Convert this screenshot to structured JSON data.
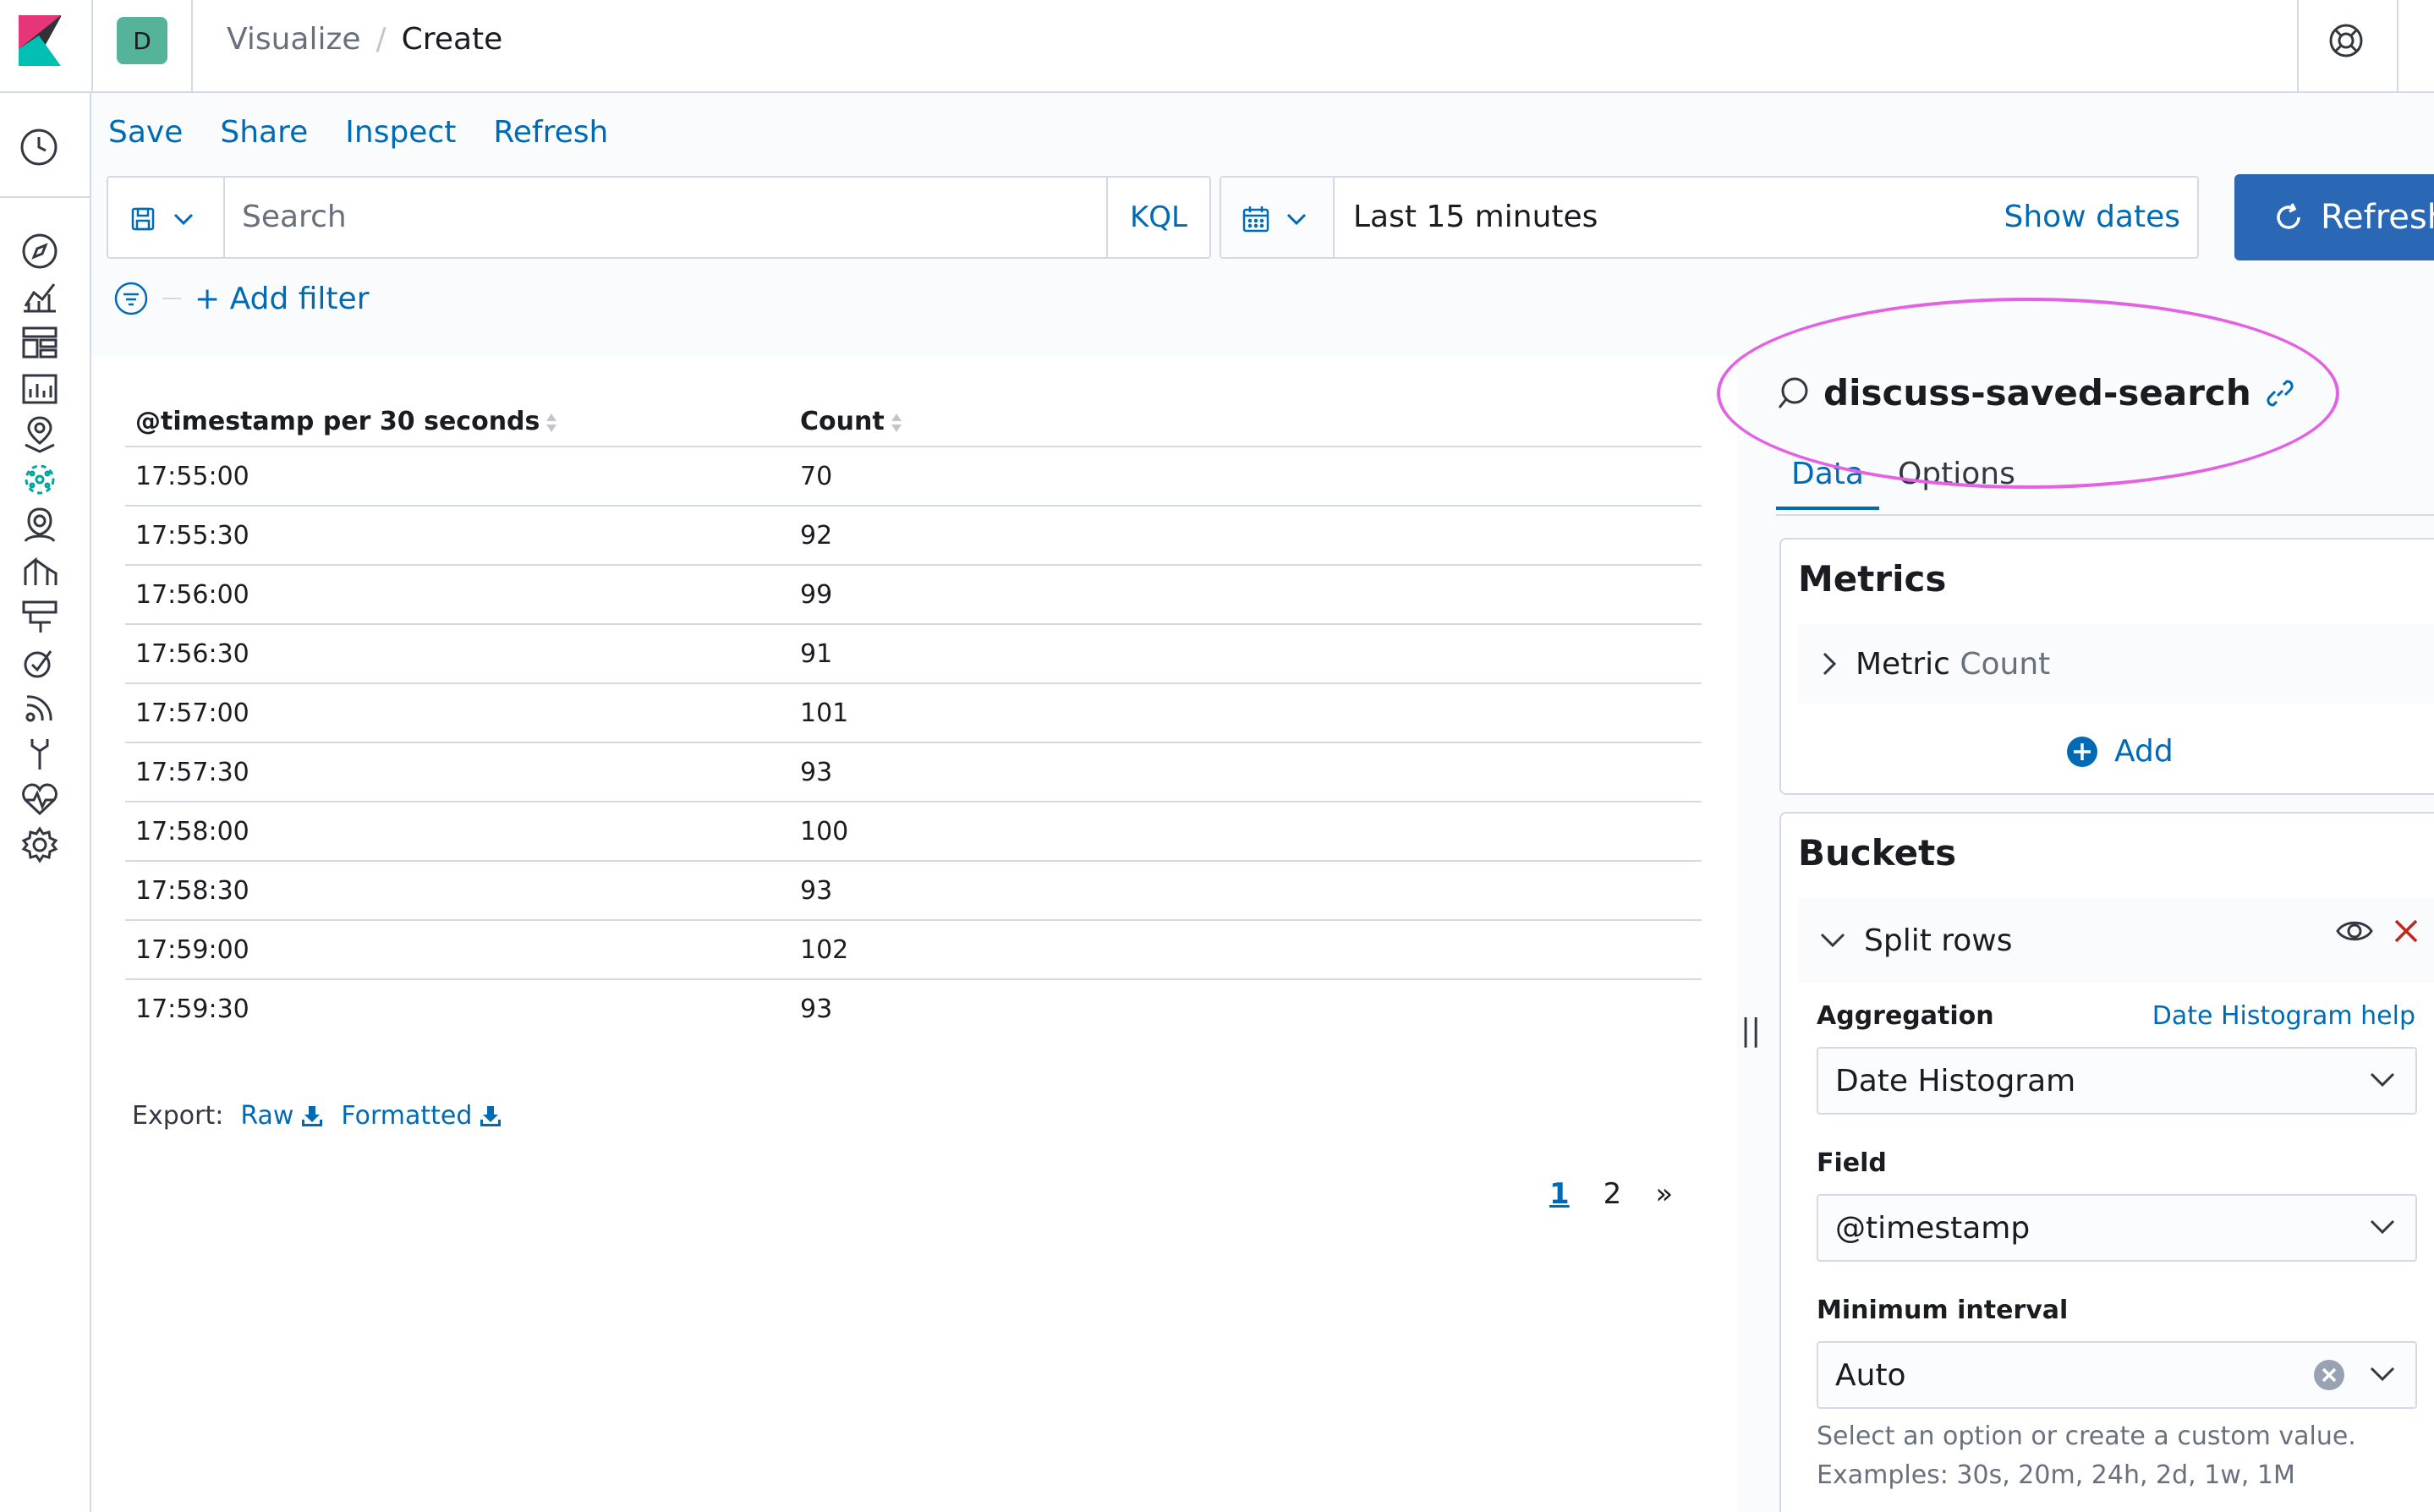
{
  "header": {
    "space_initial": "D",
    "breadcrumbs": [
      "Visualize",
      "/",
      "Create"
    ]
  },
  "nav": {
    "icons": [
      "recently-viewed-icon",
      "discover-icon",
      "visualize-icon",
      "dashboard-icon",
      "canvas-icon",
      "maps-icon",
      "machine-learning-icon",
      "siem-icon",
      "apm-icon",
      "uptime-icon",
      "graph-icon",
      "infrastructure-icon",
      "dev-tools-icon",
      "stack-monitoring-icon",
      "management-icon"
    ]
  },
  "top_actions": [
    "Save",
    "Share",
    "Inspect",
    "Refresh"
  ],
  "query_bar": {
    "placeholder": "Search",
    "language": "KQL"
  },
  "date_picker": {
    "range": "Last 15 minutes",
    "show_dates": "Show dates"
  },
  "refresh_button": "Refresh",
  "filter": {
    "add_label": "+ Add filter"
  },
  "table": {
    "columns": [
      "@timestamp per 30 seconds",
      "Count"
    ],
    "rows": [
      [
        "17:55:00",
        "70"
      ],
      [
        "17:55:30",
        "92"
      ],
      [
        "17:56:00",
        "99"
      ],
      [
        "17:56:30",
        "91"
      ],
      [
        "17:57:00",
        "101"
      ],
      [
        "17:57:30",
        "93"
      ],
      [
        "17:58:00",
        "100"
      ],
      [
        "17:58:30",
        "93"
      ],
      [
        "17:59:00",
        "102"
      ],
      [
        "17:59:30",
        "93"
      ]
    ],
    "export_label": "Export:",
    "export_raw": "Raw",
    "export_formatted": "Formatted",
    "pages": [
      "1",
      "2",
      "»"
    ],
    "current_page": "1"
  },
  "sidebar": {
    "saved_search_title": "discuss-saved-search",
    "tabs": [
      "Data",
      "Options"
    ],
    "metrics": {
      "title": "Metrics",
      "item_label": "Metric",
      "item_agg": "Count",
      "add_label": "Add"
    },
    "buckets": {
      "title": "Buckets",
      "item_label": "Split rows",
      "aggregation_label": "Aggregation",
      "aggregation_help": "Date Histogram help",
      "aggregation_value": "Date Histogram",
      "field_label": "Field",
      "field_value": "@timestamp",
      "interval_label": "Minimum interval",
      "interval_value": "Auto",
      "interval_help_1": "Select an option or create a custom value.",
      "interval_help_2": "Examples: 30s, 20m, 24h, 2d, 1w, 1M"
    }
  },
  "colors": {
    "link": "#006bb4",
    "primary_button": "#2a67b5",
    "highlight_annotation": "#e361e3",
    "space_avatar": "#54b399",
    "danger": "#bd271e"
  }
}
